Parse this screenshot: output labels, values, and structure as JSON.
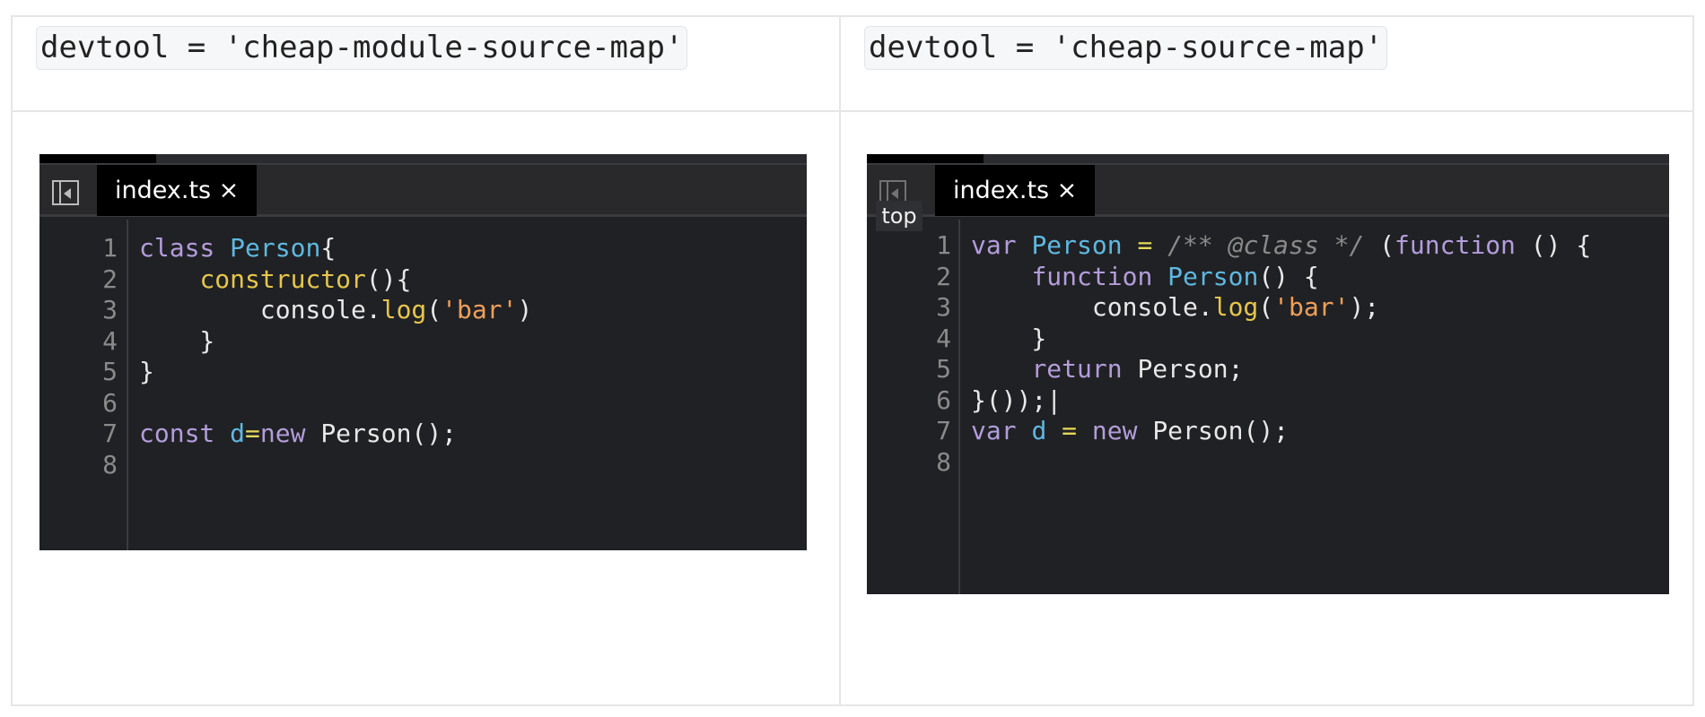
{
  "headers": [
    "devtool = 'cheap-module-source-map'",
    "devtool = 'cheap-source-map'"
  ],
  "left": {
    "tab_label": "index.ts ×",
    "line_numbers": [
      "1",
      "2",
      "3",
      "4",
      "5",
      "6",
      "7",
      "8"
    ],
    "lines": [
      [
        [
          "kw",
          "class "
        ],
        [
          "ty",
          "Person"
        ],
        [
          "",
          "{"
        ]
      ],
      [
        [
          "",
          "    "
        ],
        [
          "fn",
          "constructor"
        ],
        [
          "",
          "(){"
        ]
      ],
      [
        [
          "",
          "        console."
        ],
        [
          "fn",
          "log"
        ],
        [
          "",
          "("
        ],
        [
          "st",
          "'bar'"
        ],
        [
          "",
          ")"
        ]
      ],
      [
        [
          "",
          "    }"
        ]
      ],
      [
        [
          "",
          "}"
        ]
      ],
      [],
      [
        [
          "kw",
          "const "
        ],
        [
          "ty",
          "d"
        ],
        [
          "op",
          "="
        ],
        [
          "kw",
          "new "
        ],
        [
          "",
          "Person();"
        ]
      ],
      []
    ]
  },
  "right": {
    "tab_label": "index.ts ×",
    "top_label": "top",
    "line_numbers": [
      "1",
      "2",
      "3",
      "4",
      "5",
      "6",
      "7",
      "8"
    ],
    "lines": [
      [
        [
          "kw",
          "var "
        ],
        [
          "ty",
          "Person"
        ],
        [
          "op",
          " = "
        ],
        [
          "cm",
          "/** @class */"
        ],
        [
          "",
          " ("
        ],
        [
          "kw",
          "function"
        ],
        [
          "",
          " () {"
        ]
      ],
      [
        [
          "",
          "    "
        ],
        [
          "kw",
          "function "
        ],
        [
          "ty",
          "Person"
        ],
        [
          "",
          "() {"
        ]
      ],
      [
        [
          "",
          "        console."
        ],
        [
          "fn",
          "log"
        ],
        [
          "",
          "("
        ],
        [
          "st",
          "'bar'"
        ],
        [
          "",
          "); "
        ]
      ],
      [
        [
          "",
          "    }"
        ]
      ],
      [
        [
          "",
          "    "
        ],
        [
          "kw",
          "return "
        ],
        [
          "",
          "Person;"
        ]
      ],
      [
        [
          "",
          "}());|"
        ]
      ],
      [
        [
          "kw",
          "var "
        ],
        [
          "ty",
          "d"
        ],
        [
          "op",
          " = "
        ],
        [
          "kw",
          "new "
        ],
        [
          "",
          "Person();"
        ]
      ],
      []
    ]
  }
}
